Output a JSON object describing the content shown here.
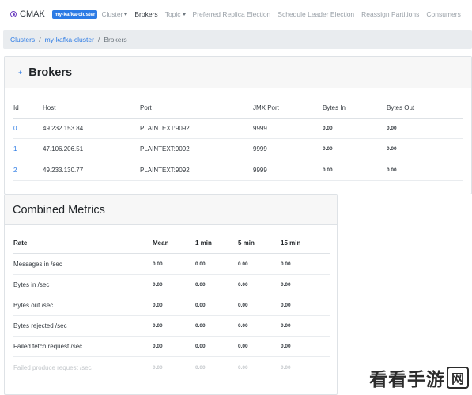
{
  "navbar": {
    "brand": "CMAK",
    "cluster_badge": "my-kafka-cluster",
    "items": [
      {
        "label": "Cluster",
        "dropdown": true,
        "active": false
      },
      {
        "label": "Brokers",
        "dropdown": false,
        "active": true
      },
      {
        "label": "Topic",
        "dropdown": true,
        "active": false
      },
      {
        "label": "Preferred Replica Election",
        "dropdown": false,
        "active": false
      },
      {
        "label": "Schedule Leader Election",
        "dropdown": false,
        "active": false
      },
      {
        "label": "Reassign Partitions",
        "dropdown": false,
        "active": false
      },
      {
        "label": "Consumers",
        "dropdown": false,
        "active": false
      }
    ]
  },
  "breadcrumb": {
    "items": [
      "Clusters",
      "my-kafka-cluster"
    ],
    "current": "Brokers"
  },
  "brokers": {
    "back_icon": "+",
    "title": "Brokers",
    "columns": [
      "Id",
      "Host",
      "Port",
      "JMX Port",
      "Bytes In",
      "Bytes Out"
    ],
    "rows": [
      [
        "0",
        "49.232.153.84",
        "PLAINTEXT:9092",
        "9999",
        "0.00",
        "0.00"
      ],
      [
        "1",
        "47.106.206.51",
        "PLAINTEXT:9092",
        "9999",
        "0.00",
        "0.00"
      ],
      [
        "2",
        "49.233.130.77",
        "PLAINTEXT:9092",
        "9999",
        "0.00",
        "0.00"
      ]
    ]
  },
  "metrics": {
    "title": "Combined Metrics",
    "columns": [
      "Rate",
      "Mean",
      "1 min",
      "5 min",
      "15 min"
    ],
    "rows": [
      [
        "Messages in /sec",
        "0.00",
        "0.00",
        "0.00",
        "0.00"
      ],
      [
        "Bytes in /sec",
        "0.00",
        "0.00",
        "0.00",
        "0.00"
      ],
      [
        "Bytes out /sec",
        "0.00",
        "0.00",
        "0.00",
        "0.00"
      ],
      [
        "Bytes rejected /sec",
        "0.00",
        "0.00",
        "0.00",
        "0.00"
      ],
      [
        "Failed fetch request /sec",
        "0.00",
        "0.00",
        "0.00",
        "0.00"
      ],
      [
        "Failed produce request /sec",
        "0.00",
        "0.00",
        "0.00",
        "0.00"
      ]
    ]
  },
  "watermark": {
    "text": "看看手游",
    "badge": "网"
  },
  "colors": {
    "accent": "#2c7be5",
    "brand_icon": "#6f42c1",
    "header_bg": "#f7f7f7",
    "breadcrumb_bg": "#e9ecef"
  }
}
